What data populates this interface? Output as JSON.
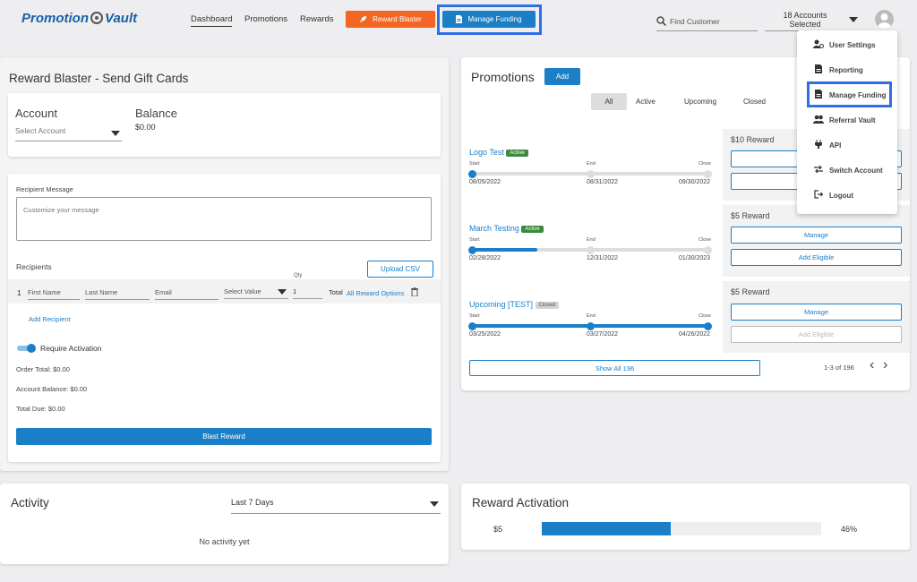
{
  "header": {
    "logo_text": "Promotion",
    "logo_text2": "Vault",
    "nav": [
      "Dashboard",
      "Promotions",
      "Rewards"
    ],
    "reward_blaster_label": "Reward Blaster",
    "manage_funding_label": "Manage Funding",
    "find_customer_placeholder": "Find Customer",
    "accounts_selected_line1": "18 Accounts",
    "accounts_selected_line2": "Selected"
  },
  "user_menu": {
    "items": [
      {
        "label": "User Settings",
        "icon": "user-gear-icon"
      },
      {
        "label": "Reporting",
        "icon": "document-icon"
      },
      {
        "label": "Manage Funding",
        "icon": "document-icon"
      },
      {
        "label": "Referral Vault",
        "icon": "users-icon"
      },
      {
        "label": "API",
        "icon": "plug-icon"
      },
      {
        "label": "Switch Account",
        "icon": "swap-icon"
      },
      {
        "label": "Logout",
        "icon": "logout-icon"
      }
    ]
  },
  "reward_blaster": {
    "title": "Reward Blaster - Send Gift Cards",
    "account_label": "Account",
    "account_placeholder": "Select Account",
    "balance_label": "Balance",
    "balance_value": "$0.00",
    "recipient_message_label": "Recipient Message",
    "message_placeholder": "Customize your message",
    "recipients_label": "Recipients",
    "upload_csv_label": "Upload CSV",
    "row_index": "1",
    "first_name_placeholder": "First Name",
    "last_name_placeholder": "Last Name",
    "email_placeholder": "Email",
    "select_value_placeholder": "Select Value",
    "qty_label": "Qty",
    "qty_value": "1",
    "total_label": "Total",
    "all_reward_options": "All Reward Options",
    "add_recipient": "Add Recipient",
    "require_activation": "Require Activation",
    "order_total": "Order Total: $0.00",
    "account_balance": "Account Balance: $0.00",
    "total_due": "Total Due: $0.00",
    "blast_reward": "Blast Reward"
  },
  "promotions": {
    "title": "Promotions",
    "add_label": "Add",
    "filters": [
      "All",
      "Active",
      "Upcoming",
      "Closed"
    ],
    "start_label": "Start",
    "end_label": "End",
    "close_label": "Close",
    "items": [
      {
        "name": "Logo Test",
        "status": "Active",
        "start": "08/05/2022",
        "end": "08/31/2022",
        "close": "09/30/2022",
        "progress": 0.0,
        "reward": "$10 Reward"
      },
      {
        "name": "March Testing",
        "status": "Active",
        "start": "02/28/2022",
        "end": "12/31/2022",
        "close": "01/30/2023",
        "progress": 0.28,
        "reward": "$5 Reward"
      },
      {
        "name": "Upcoming [TEST]",
        "status": "Closed",
        "start": "03/25/2022",
        "end": "03/27/2022",
        "close": "04/26/2022",
        "progress": 1.0,
        "reward": "$5 Reward"
      }
    ],
    "manage_label": "Manage",
    "add_eligible_label": "Add Eligible",
    "show_all_label": "Show All 196",
    "pagination": "1-3 of 196"
  },
  "activity": {
    "title": "Activity",
    "range": "Last 7 Days",
    "empty": "No activity yet"
  },
  "reward_activation": {
    "title": "Reward Activation",
    "label": "$5",
    "percent_text": "46%",
    "percent": 0.46
  },
  "colors": {
    "accent": "#1a7fc7",
    "reward_blaster_btn": "#f26522",
    "active_badge": "#3b8a3e",
    "closed_badge": "#d4d4d4",
    "highlight_box": "#2f6fe6"
  }
}
